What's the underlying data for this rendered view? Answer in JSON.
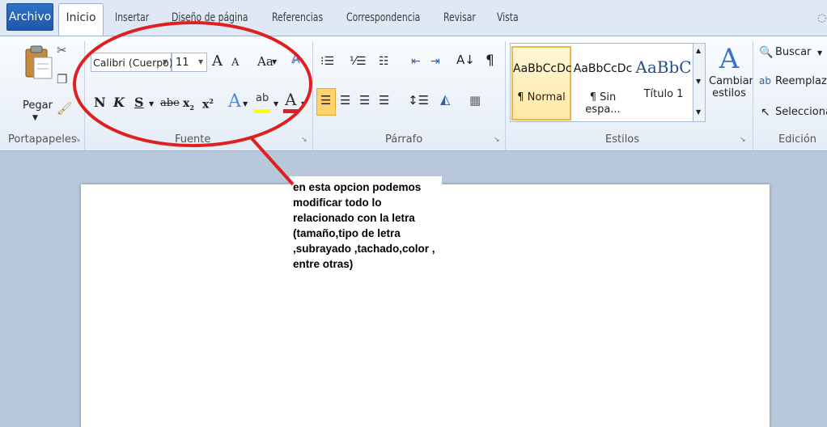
{
  "tabs": {
    "archivo": "Archivo",
    "inicio": "Inicio",
    "insertar": "Insertar",
    "diseno": "Diseño de página",
    "referencias": "Referencias",
    "correspondencia": "Correspondencia",
    "revisar": "Revisar",
    "vista": "Vista"
  },
  "clipboard": {
    "pegar": "Pegar",
    "label": "Portapapeles"
  },
  "font": {
    "name": "Calibri (Cuerpo)",
    "size": "11",
    "grow": "A",
    "shrink": "A",
    "case": "Aa",
    "bold": "N",
    "italic": "K",
    "underline": "S",
    "strike": "abe",
    "sub": "x",
    "sup": "x",
    "label": "Fuente"
  },
  "paragraph": {
    "label": "Párrafo",
    "pilcrow": "¶"
  },
  "styles": {
    "items": [
      {
        "preview": "AaBbCcDc",
        "name": "¶ Normal"
      },
      {
        "preview": "AaBbCcDc",
        "name": "¶ Sin espa..."
      },
      {
        "preview": "AaBbC",
        "name": "Título 1"
      }
    ],
    "cambiar": "Cambiar",
    "estilos": "estilos",
    "label": "Estilos"
  },
  "editing": {
    "buscar": "Buscar",
    "reemplazar": "Reemplazar",
    "seleccionar": "Seleccionar",
    "label": "Edición"
  },
  "annotation": {
    "text": "en esta opcion podemos modificar todo lo relacionado con la letra (tamaño,tipo de letra ,subrayado ,tachado,color , entre otras)",
    "circle_color": "#e02020"
  }
}
